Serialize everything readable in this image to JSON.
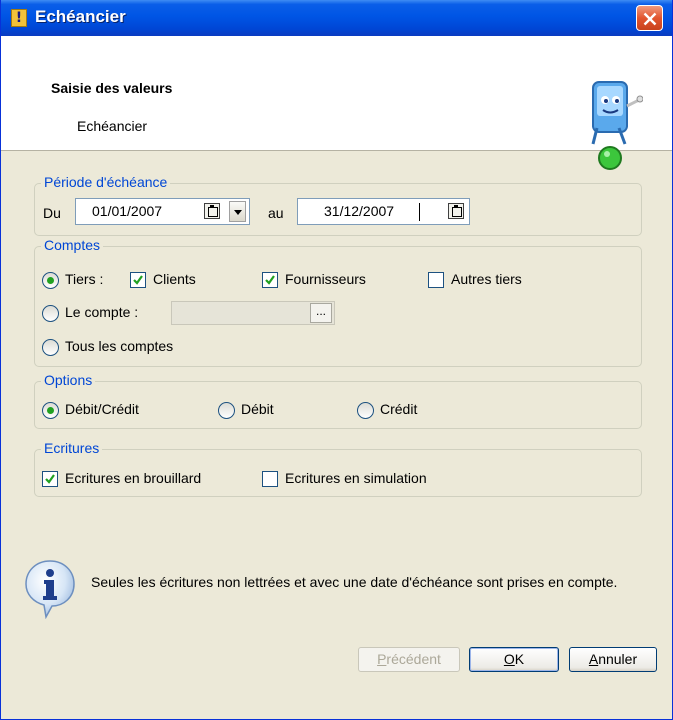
{
  "window": {
    "title": "Echéancier"
  },
  "header": {
    "title": "Saisie des valeurs",
    "subtitle": "Echéancier"
  },
  "periode": {
    "legend": "Période d'échéance",
    "du_label": "Du",
    "date_from": "01/01/2007",
    "au_label": "au",
    "date_to": "31/12/2007"
  },
  "comptes": {
    "legend": "Comptes",
    "tiers_label": "Tiers :",
    "clients_label": "Clients",
    "fournisseurs_label": "Fournisseurs",
    "autres_label": "Autres tiers",
    "compte_label": "Le compte :",
    "compte_browse": "...",
    "tous_label": "Tous les comptes"
  },
  "options": {
    "legend": "Options",
    "debit_credit_label": "Débit/Crédit",
    "debit_label": "Débit",
    "credit_label": "Crédit"
  },
  "ecritures": {
    "legend": "Ecritures",
    "brouillard_label": "Ecritures en brouillard",
    "simulation_label": "Ecritures en simulation"
  },
  "info": {
    "text": "Seules les écritures non lettrées et avec une date d'échéance sont prises en compte."
  },
  "buttons": {
    "prev_m": "P",
    "prev_rest": "récédent",
    "ok_m": "O",
    "ok_rest": "K",
    "cancel_m": "A",
    "cancel_rest": "nnuler"
  },
  "state": {
    "tiers_selected": true,
    "clients_checked": true,
    "fournisseurs_checked": true,
    "autres_checked": false,
    "debit_credit_selected": true,
    "brouillard_checked": true,
    "simulation_checked": false
  },
  "colors": {
    "title_bar": "#0055e5",
    "group_legend": "#0046d5",
    "dialog_bg": "#ece9d8",
    "close_button": "#e2552f"
  }
}
